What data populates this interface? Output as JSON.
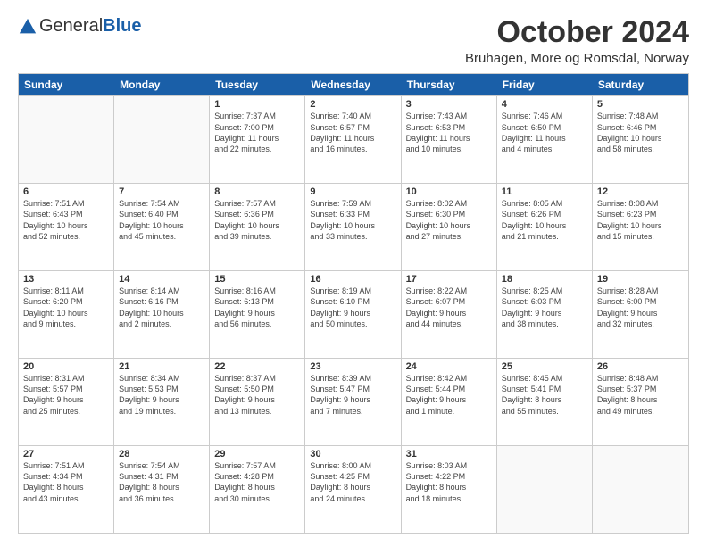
{
  "logo": {
    "general": "General",
    "blue": "Blue"
  },
  "title": "October 2024",
  "location": "Bruhagen, More og Romsdal, Norway",
  "days": [
    "Sunday",
    "Monday",
    "Tuesday",
    "Wednesday",
    "Thursday",
    "Friday",
    "Saturday"
  ],
  "weeks": [
    [
      {
        "day": "",
        "empty": true
      },
      {
        "day": "",
        "empty": true
      },
      {
        "day": "1",
        "lines": [
          "Sunrise: 7:37 AM",
          "Sunset: 7:00 PM",
          "Daylight: 11 hours",
          "and 22 minutes."
        ]
      },
      {
        "day": "2",
        "lines": [
          "Sunrise: 7:40 AM",
          "Sunset: 6:57 PM",
          "Daylight: 11 hours",
          "and 16 minutes."
        ]
      },
      {
        "day": "3",
        "lines": [
          "Sunrise: 7:43 AM",
          "Sunset: 6:53 PM",
          "Daylight: 11 hours",
          "and 10 minutes."
        ]
      },
      {
        "day": "4",
        "lines": [
          "Sunrise: 7:46 AM",
          "Sunset: 6:50 PM",
          "Daylight: 11 hours",
          "and 4 minutes."
        ]
      },
      {
        "day": "5",
        "lines": [
          "Sunrise: 7:48 AM",
          "Sunset: 6:46 PM",
          "Daylight: 10 hours",
          "and 58 minutes."
        ]
      }
    ],
    [
      {
        "day": "6",
        "lines": [
          "Sunrise: 7:51 AM",
          "Sunset: 6:43 PM",
          "Daylight: 10 hours",
          "and 52 minutes."
        ]
      },
      {
        "day": "7",
        "lines": [
          "Sunrise: 7:54 AM",
          "Sunset: 6:40 PM",
          "Daylight: 10 hours",
          "and 45 minutes."
        ]
      },
      {
        "day": "8",
        "lines": [
          "Sunrise: 7:57 AM",
          "Sunset: 6:36 PM",
          "Daylight: 10 hours",
          "and 39 minutes."
        ]
      },
      {
        "day": "9",
        "lines": [
          "Sunrise: 7:59 AM",
          "Sunset: 6:33 PM",
          "Daylight: 10 hours",
          "and 33 minutes."
        ]
      },
      {
        "day": "10",
        "lines": [
          "Sunrise: 8:02 AM",
          "Sunset: 6:30 PM",
          "Daylight: 10 hours",
          "and 27 minutes."
        ]
      },
      {
        "day": "11",
        "lines": [
          "Sunrise: 8:05 AM",
          "Sunset: 6:26 PM",
          "Daylight: 10 hours",
          "and 21 minutes."
        ]
      },
      {
        "day": "12",
        "lines": [
          "Sunrise: 8:08 AM",
          "Sunset: 6:23 PM",
          "Daylight: 10 hours",
          "and 15 minutes."
        ]
      }
    ],
    [
      {
        "day": "13",
        "lines": [
          "Sunrise: 8:11 AM",
          "Sunset: 6:20 PM",
          "Daylight: 10 hours",
          "and 9 minutes."
        ]
      },
      {
        "day": "14",
        "lines": [
          "Sunrise: 8:14 AM",
          "Sunset: 6:16 PM",
          "Daylight: 10 hours",
          "and 2 minutes."
        ]
      },
      {
        "day": "15",
        "lines": [
          "Sunrise: 8:16 AM",
          "Sunset: 6:13 PM",
          "Daylight: 9 hours",
          "and 56 minutes."
        ]
      },
      {
        "day": "16",
        "lines": [
          "Sunrise: 8:19 AM",
          "Sunset: 6:10 PM",
          "Daylight: 9 hours",
          "and 50 minutes."
        ]
      },
      {
        "day": "17",
        "lines": [
          "Sunrise: 8:22 AM",
          "Sunset: 6:07 PM",
          "Daylight: 9 hours",
          "and 44 minutes."
        ]
      },
      {
        "day": "18",
        "lines": [
          "Sunrise: 8:25 AM",
          "Sunset: 6:03 PM",
          "Daylight: 9 hours",
          "and 38 minutes."
        ]
      },
      {
        "day": "19",
        "lines": [
          "Sunrise: 8:28 AM",
          "Sunset: 6:00 PM",
          "Daylight: 9 hours",
          "and 32 minutes."
        ]
      }
    ],
    [
      {
        "day": "20",
        "lines": [
          "Sunrise: 8:31 AM",
          "Sunset: 5:57 PM",
          "Daylight: 9 hours",
          "and 25 minutes."
        ]
      },
      {
        "day": "21",
        "lines": [
          "Sunrise: 8:34 AM",
          "Sunset: 5:53 PM",
          "Daylight: 9 hours",
          "and 19 minutes."
        ]
      },
      {
        "day": "22",
        "lines": [
          "Sunrise: 8:37 AM",
          "Sunset: 5:50 PM",
          "Daylight: 9 hours",
          "and 13 minutes."
        ]
      },
      {
        "day": "23",
        "lines": [
          "Sunrise: 8:39 AM",
          "Sunset: 5:47 PM",
          "Daylight: 9 hours",
          "and 7 minutes."
        ]
      },
      {
        "day": "24",
        "lines": [
          "Sunrise: 8:42 AM",
          "Sunset: 5:44 PM",
          "Daylight: 9 hours",
          "and 1 minute."
        ]
      },
      {
        "day": "25",
        "lines": [
          "Sunrise: 8:45 AM",
          "Sunset: 5:41 PM",
          "Daylight: 8 hours",
          "and 55 minutes."
        ]
      },
      {
        "day": "26",
        "lines": [
          "Sunrise: 8:48 AM",
          "Sunset: 5:37 PM",
          "Daylight: 8 hours",
          "and 49 minutes."
        ]
      }
    ],
    [
      {
        "day": "27",
        "lines": [
          "Sunrise: 7:51 AM",
          "Sunset: 4:34 PM",
          "Daylight: 8 hours",
          "and 43 minutes."
        ]
      },
      {
        "day": "28",
        "lines": [
          "Sunrise: 7:54 AM",
          "Sunset: 4:31 PM",
          "Daylight: 8 hours",
          "and 36 minutes."
        ]
      },
      {
        "day": "29",
        "lines": [
          "Sunrise: 7:57 AM",
          "Sunset: 4:28 PM",
          "Daylight: 8 hours",
          "and 30 minutes."
        ]
      },
      {
        "day": "30",
        "lines": [
          "Sunrise: 8:00 AM",
          "Sunset: 4:25 PM",
          "Daylight: 8 hours",
          "and 24 minutes."
        ]
      },
      {
        "day": "31",
        "lines": [
          "Sunrise: 8:03 AM",
          "Sunset: 4:22 PM",
          "Daylight: 8 hours",
          "and 18 minutes."
        ]
      },
      {
        "day": "",
        "empty": true
      },
      {
        "day": "",
        "empty": true
      }
    ]
  ]
}
